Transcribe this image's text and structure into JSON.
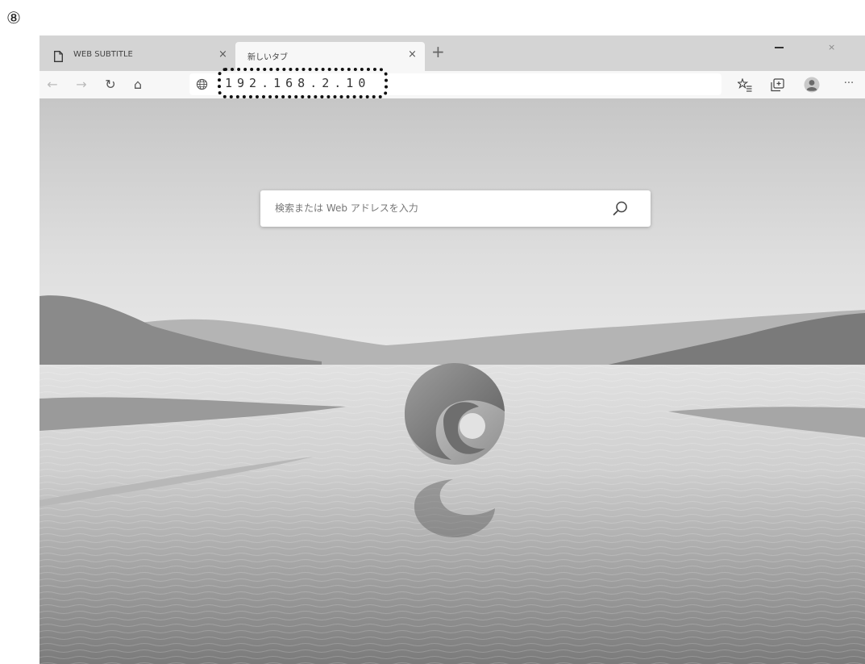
{
  "step_marker": "⑧",
  "tabs": [
    {
      "label": "WEB SUBTITLE",
      "close": "×",
      "active": false
    },
    {
      "label": "新しいタブ",
      "close": "×",
      "active": true
    }
  ],
  "new_tab": "+",
  "window_controls": {
    "close": "×"
  },
  "toolbar": {
    "back": "←",
    "forward": "→",
    "refresh": "↻",
    "home": "⌂",
    "more": "···"
  },
  "address_bar": {
    "value": "192.168.2.10",
    "icon": "globe-icon"
  },
  "new_tab_page": {
    "search_placeholder": "検索または Web アドレスを入力"
  },
  "colors": {
    "toolbar": "#f7f7f7",
    "tabbar": "#d4d4d4"
  }
}
